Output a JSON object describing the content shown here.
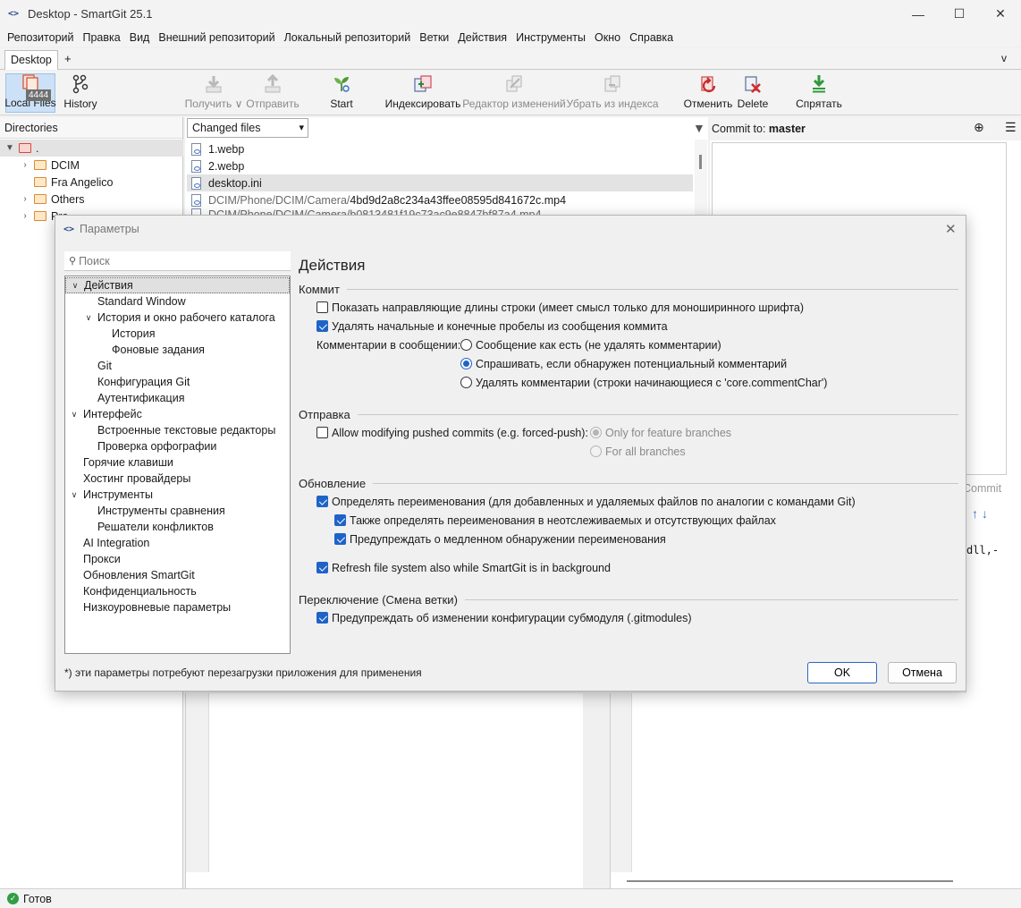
{
  "window": {
    "title": "Desktop - SmartGit 25.1",
    "minimize": "—",
    "maximize": "☐",
    "close": "✕"
  },
  "menu": [
    "Репозиторий",
    "Правка",
    "Вид",
    "Внешний репозиторий",
    "Локальный репозиторий",
    "Ветки",
    "Действия",
    "Инструменты",
    "Окно",
    "Справка"
  ],
  "tabs": {
    "active": "Desktop",
    "add": "+",
    "dropdown": "v"
  },
  "toolbar": {
    "local_files": "Local Files",
    "badge": "4444",
    "history": "History",
    "pull": "Получить ∨",
    "push": "Отправить",
    "start": "Start",
    "stage": "Индексировать",
    "change_editor": "Редактор изменений",
    "unstage": "Убрать из индекса",
    "discard": "Отменить",
    "delete": "Delete",
    "stash": "Спрятать"
  },
  "directories": {
    "header": "Directories",
    "root": ".",
    "items": [
      "DCIM",
      "Fra Angelico",
      "Others",
      "Pro"
    ]
  },
  "files": {
    "selector": "Changed files",
    "rows": [
      {
        "prefix": "",
        "name": "1.webp"
      },
      {
        "prefix": "",
        "name": "2.webp"
      },
      {
        "prefix": "",
        "name": "desktop.ini"
      },
      {
        "prefix": "DCIM/Phone/DCIM/Camera/",
        "name": "4bd9d2a8c234a43ffee08595d841672c.mp4"
      },
      {
        "prefix": "DCIM/Phone/DCIM/Camera/",
        "name": "b0813481f19c73ac9e8847bf87a4.mp4"
      }
    ]
  },
  "commit": {
    "label": "Commit to:",
    "branch": "master",
    "button": "Commit",
    "code_fragment": "dll,-"
  },
  "status": {
    "text": "Готов"
  },
  "dialog": {
    "title": "Параметры",
    "search_placeholder": "Поиск",
    "nav": [
      {
        "label": "Действия",
        "level": 0,
        "expanded": true,
        "selected": true
      },
      {
        "label": "Standard Window",
        "level": 1
      },
      {
        "label": "История и окно рабочего каталога",
        "level": 1,
        "expanded": true
      },
      {
        "label": "История",
        "level": 2
      },
      {
        "label": "Фоновые задания",
        "level": 2
      },
      {
        "label": "Git",
        "level": 1
      },
      {
        "label": "Конфигурация Git",
        "level": 1
      },
      {
        "label": "Аутентификация",
        "level": 1
      },
      {
        "label": "Интерфейс",
        "level": 0,
        "expanded": true
      },
      {
        "label": "Встроенные текстовые редакторы",
        "level": 1
      },
      {
        "label": "Проверка орфографии",
        "level": 1
      },
      {
        "label": "Горячие клавиши",
        "level": 0
      },
      {
        "label": "Хостинг провайдеры",
        "level": 0
      },
      {
        "label": "Инструменты",
        "level": 0,
        "expanded": true
      },
      {
        "label": "Инструменты сравнения",
        "level": 1
      },
      {
        "label": "Решатели конфликтов",
        "level": 1
      },
      {
        "label": "AI Integration",
        "level": 0
      },
      {
        "label": "Прокси",
        "level": 0
      },
      {
        "label": "Обновления SmartGit",
        "level": 0
      },
      {
        "label": "Конфиденциальность",
        "level": 0
      },
      {
        "label": "Низкоуровневые параметры",
        "level": 0
      }
    ],
    "page_title": "Действия",
    "sections": {
      "commit": "Коммит",
      "push": "Отправка",
      "update": "Обновление",
      "switch": "Переключение (Смена ветки)"
    },
    "options": {
      "show_guides": "Показать направляющие длины строки (имеет смысл только для моноширинного шрифта)",
      "trim_spaces": "Удалять начальные и конечные пробелы из сообщения коммита",
      "comments_label": "Комментарии в сообщении:",
      "comments_keep": "Сообщение как есть (не удалять комментарии)",
      "comments_ask": "Спрашивать, если обнаружен потенциальный комментарий",
      "comments_remove": "Удалять комментарии (строки начинающиеся с 'core.commentChar')",
      "allow_modify_pushed": "Allow modifying pushed commits (e.g. forced-push):",
      "only_feature": "Only for feature branches",
      "all_branches": "For all branches",
      "detect_renames": "Определять переименования (для добавленных и удаляемых файлов по аналогии с командами Git)",
      "detect_renames_untracked": "Также определять переименования в неотслеживаемых и отсутствующих файлах",
      "warn_slow_rename": "Предупреждать о медленном обнаружении переименования",
      "refresh_background": "Refresh file system also while SmartGit is in background",
      "warn_submodule": "Предупреждать об изменении конфигурации субмодуля (.gitmodules)"
    },
    "footnote": "*) эти параметры потребуют перезагрузки приложения для применения",
    "ok": "OK",
    "cancel": "Отмена"
  }
}
